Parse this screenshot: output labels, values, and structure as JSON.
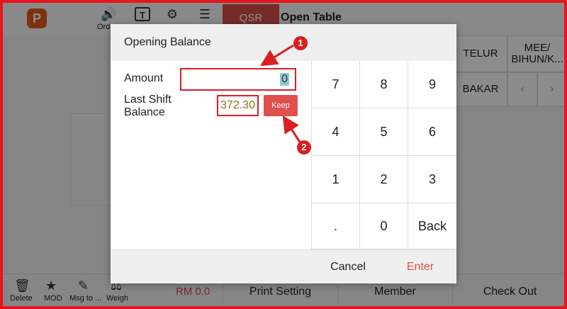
{
  "app": {
    "logo_letter": "P",
    "top_icons": [
      {
        "icon": "speaker-icon",
        "label": "Ord"
      },
      {
        "icon": "text-icon",
        "label": ""
      },
      {
        "icon": "gear-icon",
        "label": ""
      },
      {
        "icon": "list-icon",
        "label": ""
      }
    ],
    "active_tab": "QSR",
    "table_label": "Open Table",
    "menu_grid": [
      {
        "label": "TELUR"
      },
      {
        "label": "MEE/ BIHUN/K..."
      },
      {
        "label": "BAKAR"
      },
      {
        "label": "‹"
      },
      {
        "label": "›"
      }
    ],
    "bottom_actions": [
      {
        "icon": "trash-icon",
        "label": "Delete"
      },
      {
        "icon": "star-icon",
        "label": "MOD"
      },
      {
        "icon": "pencil-icon",
        "label": "Msg to ..."
      },
      {
        "icon": "scale-icon",
        "label": "Weigh"
      }
    ],
    "total": "RM 0.0",
    "print_setting": "Print Setting",
    "member": "Member",
    "check_out": "Check Out"
  },
  "dialog": {
    "title": "Opening Balance",
    "amount_label": "Amount",
    "amount_value": "0",
    "last_shift_label": "Last Shift Balance",
    "last_shift_value": "372.30",
    "keep_label": "Keep",
    "keys": [
      "7",
      "8",
      "9",
      "4",
      "5",
      "6",
      "1",
      "2",
      "3",
      ".",
      "0",
      "Back"
    ],
    "cancel_label": "Cancel",
    "enter_label": "Enter"
  },
  "callouts": [
    "1",
    "2"
  ],
  "colors": {
    "accent": "#e0504d",
    "highlight_border": "#d81f22",
    "frame": "#e8141b",
    "last_shift_text": "#9a6a1e"
  }
}
